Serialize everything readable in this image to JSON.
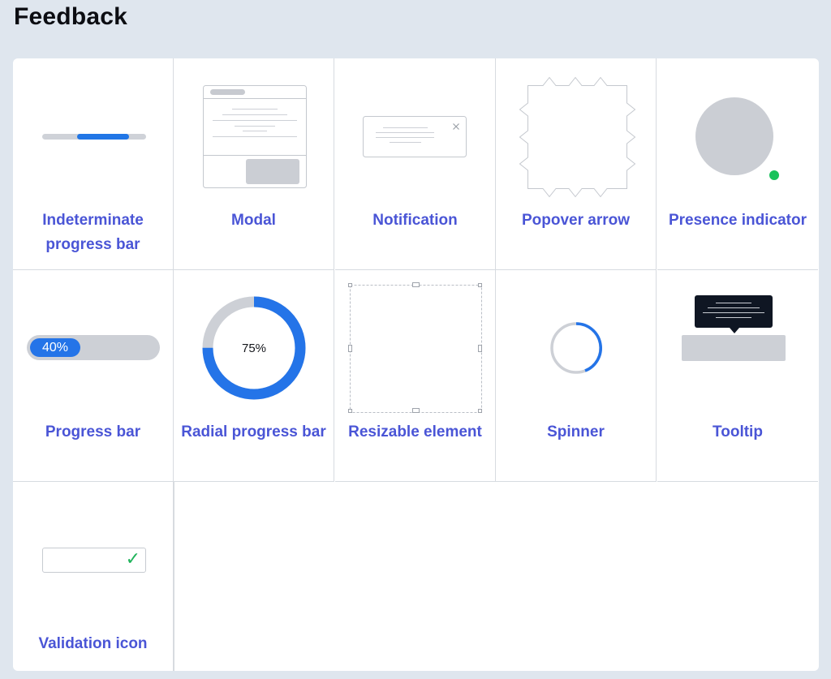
{
  "page": {
    "title": "Feedback"
  },
  "components": [
    {
      "label": "Indeterminate progress bar",
      "icon": "indeterminate-progress-illustration"
    },
    {
      "label": "Modal",
      "icon": "modal-illustration"
    },
    {
      "label": "Notification",
      "icon": "notification-illustration"
    },
    {
      "label": "Popover arrow",
      "icon": "popover-arrow-illustration"
    },
    {
      "label": "Presence indicator",
      "icon": "presence-indicator-illustration"
    },
    {
      "label": "Progress bar",
      "icon": "progress-bar-illustration",
      "value_text": "40%",
      "fraction": 0.4
    },
    {
      "label": "Radial progress bar",
      "icon": "radial-progress-illustration",
      "value_text": "75%",
      "fraction": 0.75
    },
    {
      "label": "Resizable element",
      "icon": "resizable-element-illustration"
    },
    {
      "label": "Spinner",
      "icon": "spinner-illustration"
    },
    {
      "label": "Tooltip",
      "icon": "tooltip-illustration"
    },
    {
      "label": "Validation icon",
      "icon": "validation-check-icon"
    }
  ],
  "colors": {
    "page_bg": "#dfe6ee",
    "label": "#4a55d6",
    "accent_blue": "#2474e8",
    "track_gray": "#cdd0d6",
    "success_green": "#19c25b",
    "tooltip_dark": "#0f1623"
  }
}
